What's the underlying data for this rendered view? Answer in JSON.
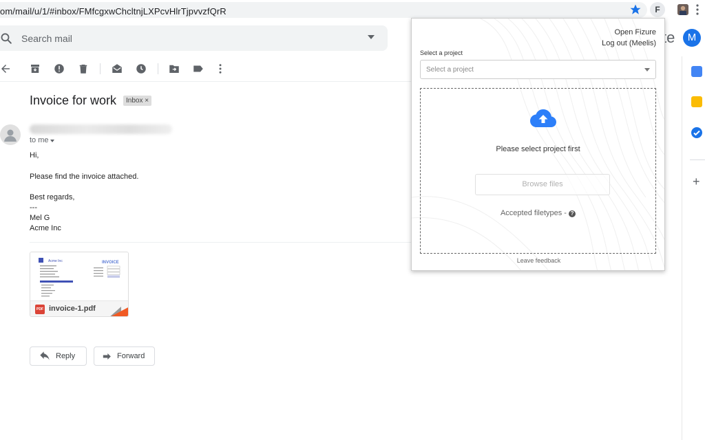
{
  "browser": {
    "url": "om/mail/u/1/#inbox/FMfcgxwChcltnjLXPcvHlrTjpvvzfQrR",
    "extension_letter": "F"
  },
  "search": {
    "placeholder": "Search mail"
  },
  "header": {
    "brand_fragment": "te",
    "avatar_letter": "M"
  },
  "toolbar": {
    "icons": [
      "back-arrow-icon",
      "archive-icon",
      "report-spam-icon",
      "delete-icon",
      "mark-unread-icon",
      "snooze-icon",
      "move-to-icon",
      "label-icon",
      "more-vert-icon"
    ]
  },
  "email": {
    "subject": "Invoice for work",
    "label_chip": "Inbox",
    "label_close": "×",
    "to": "to me",
    "body": {
      "greeting": "Hi,",
      "line1": "Please find the invoice attached.",
      "closing": "Best regards,",
      "sep": "---",
      "name": "Mel G",
      "company": "Acme Inc"
    },
    "attachment": {
      "filename": "invoice-1.pdf",
      "type_badge": "PDF",
      "preview_company": "Acme Inc",
      "preview_title": "INVOICE"
    },
    "actions": {
      "reply": "Reply",
      "forward": "Forward"
    }
  },
  "popup": {
    "open_link": "Open Fizure",
    "logout_link": "Log out (Meelis)",
    "project_label": "Select a project",
    "project_placeholder": "Select a project",
    "dropzone_message": "Please select project first",
    "browse_label": "Browse files",
    "accepted_label": "Accepted filetypes -",
    "help_glyph": "?",
    "feedback": "Leave feedback"
  },
  "colors": {
    "accent_blue": "#1a73e8",
    "cloud_blue": "#2d7ff9",
    "pdf_red": "#db4437"
  }
}
